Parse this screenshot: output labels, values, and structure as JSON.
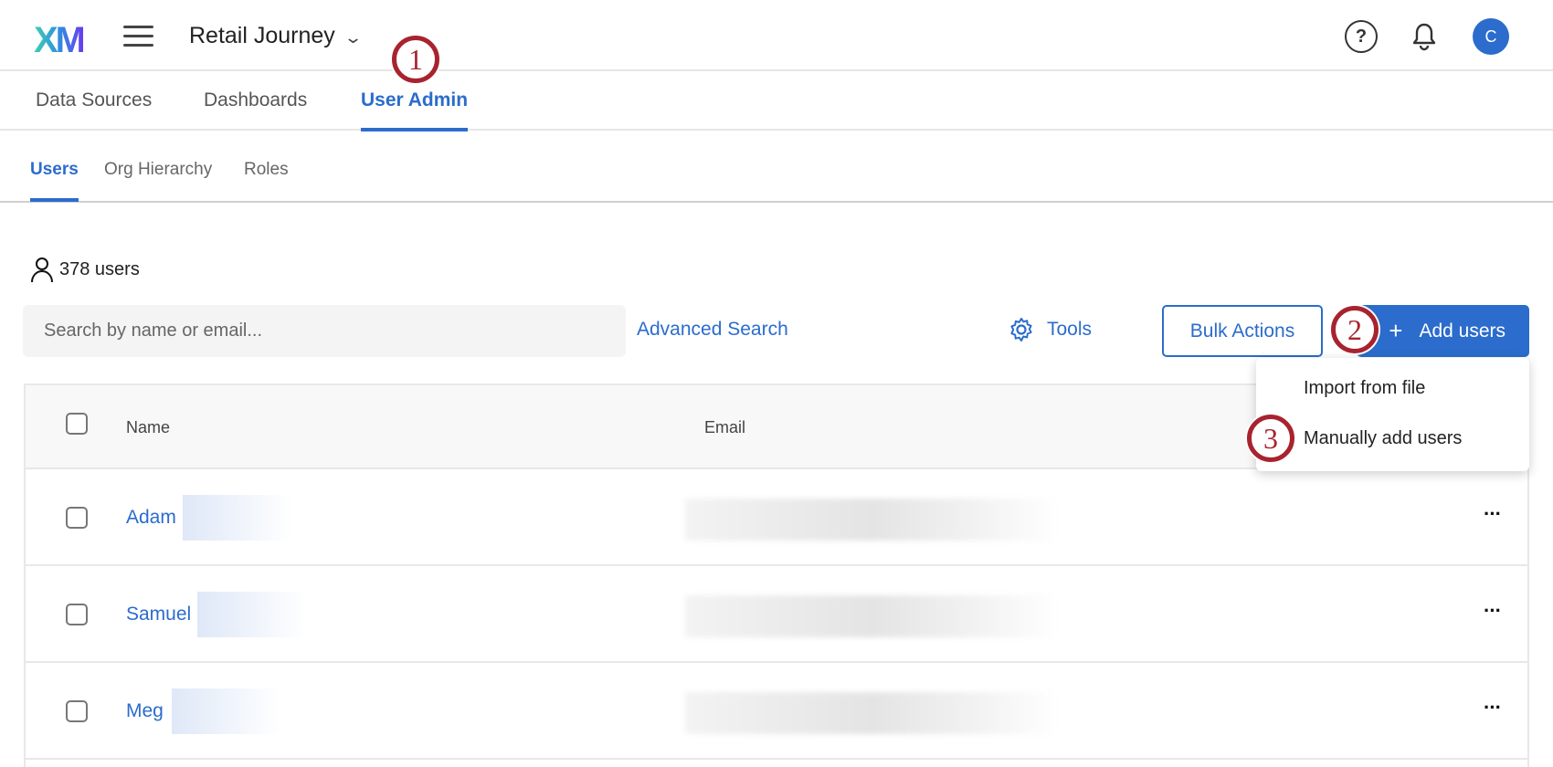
{
  "header": {
    "logo": "XM",
    "project": "Retail Journey",
    "help": "?",
    "avatar": "C"
  },
  "tabs": [
    {
      "label": "Data Sources"
    },
    {
      "label": "Dashboards"
    },
    {
      "label": "User Admin"
    }
  ],
  "subtabs": [
    {
      "label": "Users"
    },
    {
      "label": "Org Hierarchy"
    },
    {
      "label": "Roles"
    }
  ],
  "users_count": "378 users",
  "search": {
    "placeholder": "Search by name or email..."
  },
  "toolbar": {
    "advanced_search": "Advanced Search",
    "tools": "Tools",
    "bulk_actions": "Bulk Actions",
    "add_users": "Add users"
  },
  "dropdown": {
    "items": [
      {
        "label": "Import from file"
      },
      {
        "label": "Manually add users"
      }
    ]
  },
  "table": {
    "columns": {
      "name": "Name",
      "email": "Email"
    },
    "rows": [
      {
        "name": "Adam"
      },
      {
        "name": "Samuel"
      },
      {
        "name": "Meg"
      }
    ]
  },
  "annotations": [
    "1",
    "2",
    "3"
  ],
  "colors": {
    "accent": "#2b6ccc",
    "annotation": "#a8232f"
  }
}
